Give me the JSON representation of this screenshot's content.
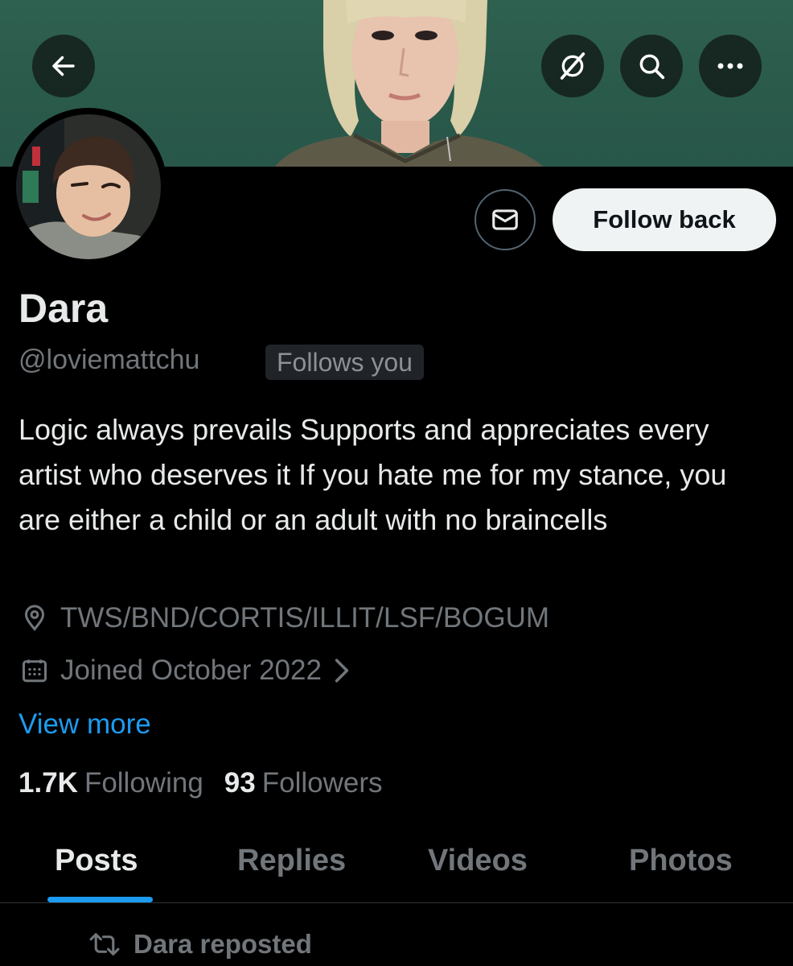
{
  "profile": {
    "name": "Dara",
    "handle": "@loviemattchu",
    "follows_you_badge": "Follows you",
    "bio": "Logic always prevails Supports and appreciates every artist who deserves it If you hate me for my stance, you are either a child or an adult with no braincells",
    "location": "TWS/BND/CORTIS/ILLIT/LSF/BOGUM",
    "joined": "Joined October 2022",
    "view_more": "View more"
  },
  "stats": {
    "following_count": "1.7K",
    "following_label": "Following",
    "followers_count": "93",
    "followers_label": "Followers"
  },
  "actions": {
    "follow_back_label": "Follow back"
  },
  "header_icons": {
    "back": "arrow-left-icon",
    "grok": "grok-icon",
    "search": "search-icon",
    "more": "more-icon",
    "message": "envelope-icon"
  },
  "tabs": [
    {
      "label": "Posts",
      "active": true
    },
    {
      "label": "Replies",
      "active": false
    },
    {
      "label": "Videos",
      "active": false
    },
    {
      "label": "Photos",
      "active": false
    }
  ],
  "feed": {
    "first_item_context": "Dara reposted"
  },
  "colors": {
    "background": "#000000",
    "accent": "#1d9bf0",
    "banner": "#2f6150",
    "muted_text": "#71767b",
    "primary_text": "#e7e9ea"
  }
}
